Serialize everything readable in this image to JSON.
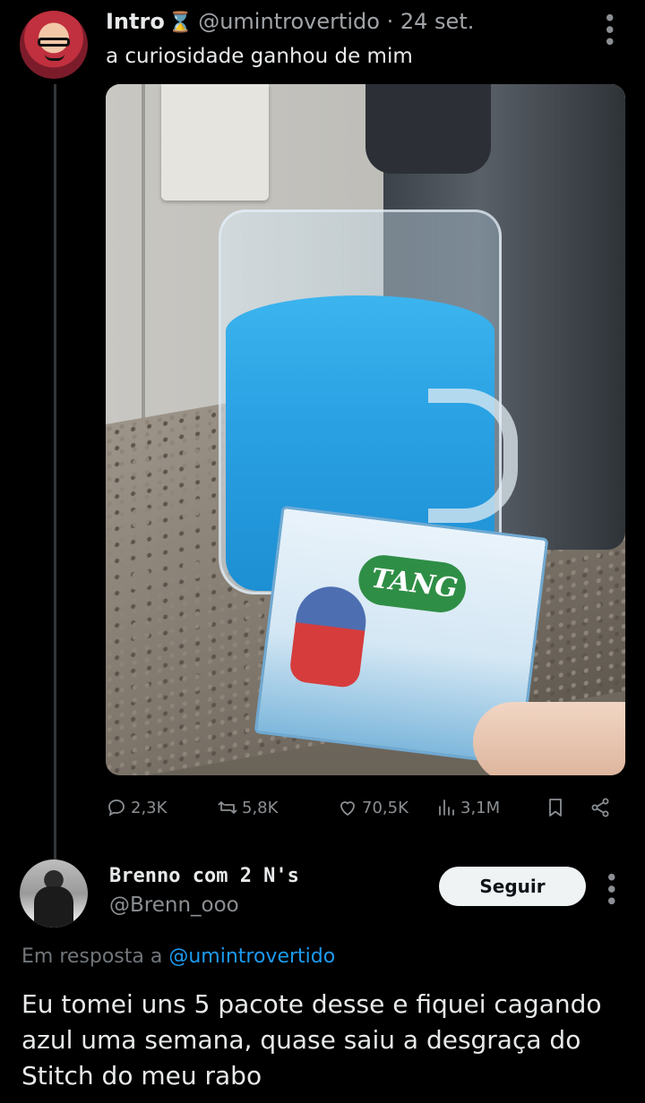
{
  "tweet1": {
    "author_name": "Intro",
    "author_emoji": "⌛",
    "handle": "@umintrovertido",
    "separator": "·",
    "date": "24 set.",
    "text": "a curiosidade ganhou de mim",
    "metrics": {
      "replies": "2,3K",
      "retweets": "5,8K",
      "likes": "70,5K",
      "views": "3,1M"
    }
  },
  "tweet2": {
    "author_name": "Brenno com 2 N's",
    "handle": "@Brenn_ooo",
    "follow_label": "Seguir",
    "reply_prefix": "Em resposta a",
    "reply_mention": "@umintrovertido",
    "text": "Eu tomei uns 5 pacote desse e fiquei cagando azul uma semana, quase saiu a desgraça do Stitch do meu rabo"
  },
  "photo": {
    "sachet_brand": "TANG"
  },
  "colors": {
    "background": "#000000",
    "text_primary": "#e7e9ea",
    "text_secondary": "#8b8f93",
    "link": "#1d9bf0",
    "button_bg": "#eff3f4"
  },
  "icons": [
    "reply-icon",
    "retweet-icon",
    "like-icon",
    "views-icon",
    "bookmark-icon",
    "share-icon",
    "more-icon"
  ]
}
